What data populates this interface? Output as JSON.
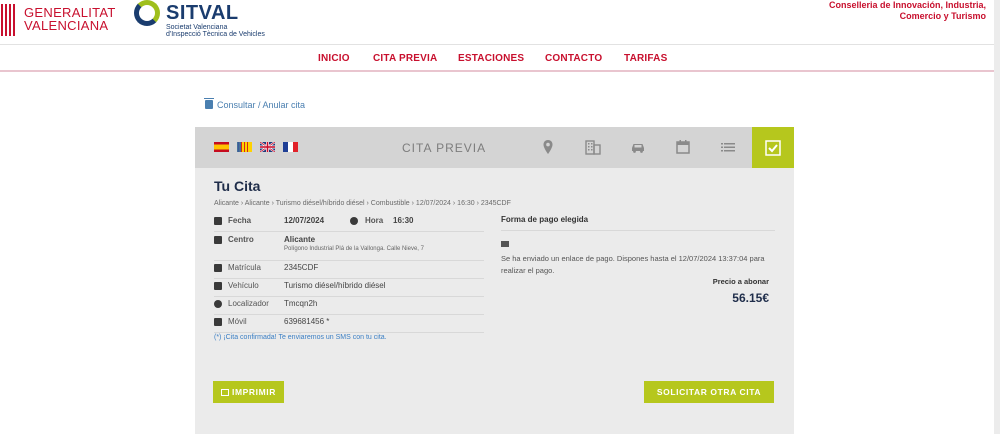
{
  "header": {
    "gv_line1": "GENERALITAT",
    "gv_line2": "VALENCIANA",
    "sitval_name": "SITVAL",
    "sitval_sub1": "Societat Valenciana",
    "sitval_sub2": "d'Inspecció Tècnica de Vehicles",
    "conselleria_line1": "Conselleria de Innovación, Industria,",
    "conselleria_line2": "Comercio y Turismo"
  },
  "nav": {
    "items": [
      "INICIO",
      "CITA PREVIA",
      "ESTACIONES",
      "CONTACTO",
      "TARIFAS"
    ]
  },
  "consultar_link": "Consultar / Anular cita",
  "panel": {
    "title": "CITA PREVIA",
    "flags": [
      "es-flag",
      "cv-flag",
      "gb-flag",
      "fr-flag"
    ],
    "step_icons": [
      "location-icon",
      "building-icon",
      "car-icon",
      "calendar-icon",
      "list-icon",
      "check-icon"
    ]
  },
  "cita": {
    "heading": "Tu Cita",
    "breadcrumb": "Alicante › Alicante › Turismo diésel/híbrido diésel › Combustible › 12/07/2024 › 16:30 › 2345CDF",
    "fecha_label": "Fecha",
    "fecha_value": "12/07/2024",
    "hora_label": "Hora",
    "hora_value": "16:30",
    "centro_label": "Centro",
    "centro_value": "Alicante",
    "centro_address": "Polígono Industrial Plá de la Vallonga. Calle Nieve, 7",
    "matricula_label": "Matrícula",
    "matricula_value": "2345CDF",
    "vehiculo_label": "Vehículo",
    "vehiculo_value": "Turismo diésel/híbrido diésel",
    "localizador_label": "Localizador",
    "localizador_value": "Tmcqn2h",
    "movil_label": "Móvil",
    "movil_value": "639681456 *",
    "sms_note": "(*) ¡Cita confirmada! Te enviaremos un SMS con tu cita."
  },
  "pago": {
    "title": "Forma de pago elegida",
    "message": "Se ha enviado un enlace de pago. Dispones hasta el 12/07/2024 13:37:04 para realizar el pago.",
    "precio_label": "Precio a abonar",
    "precio_value": "56.15€"
  },
  "buttons": {
    "imprimir": "IMPRIMIR",
    "solicitar": "SOLICITAR OTRA CITA"
  },
  "colors": {
    "brand_red": "#c8102e",
    "accent_green": "#b6c71d",
    "navy": "#1a3c6e"
  }
}
